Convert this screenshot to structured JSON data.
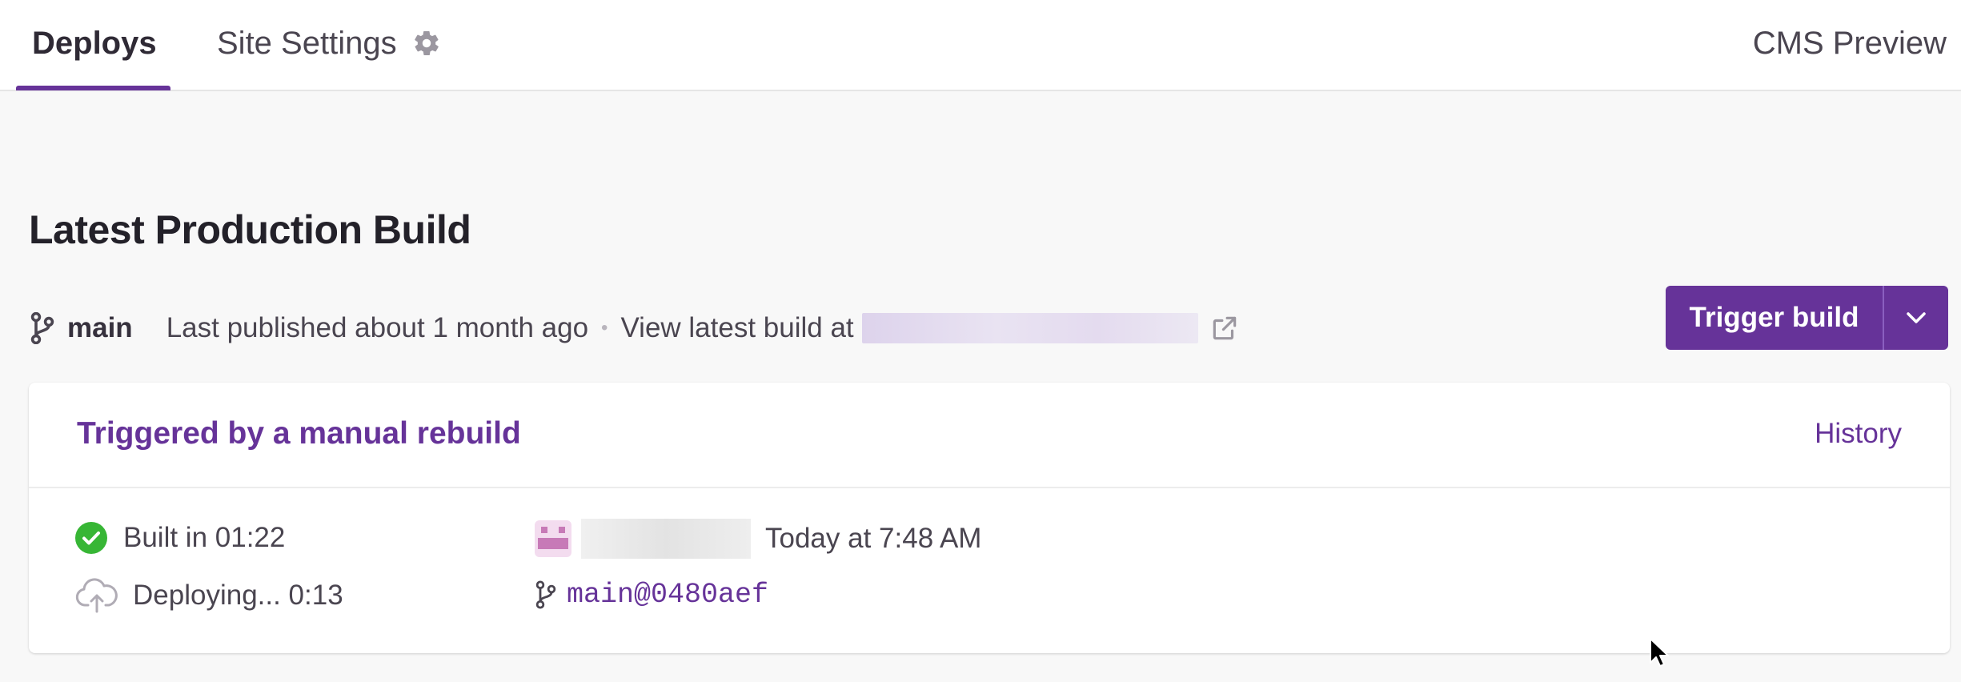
{
  "nav": {
    "tabs": [
      {
        "label": "Deploys",
        "active": true
      },
      {
        "label": "Site Settings",
        "icon": "gear-icon"
      }
    ],
    "cms_preview": "CMS Preview"
  },
  "latest_build": {
    "title": "Latest Production Build",
    "branch": "main",
    "published_text": "Last published about 1 month ago",
    "separator": "•",
    "view_latest_text": "View latest build at",
    "trigger_button": "Trigger build"
  },
  "card": {
    "title": "Triggered by a manual rebuild",
    "history_link": "History",
    "built_text": "Built in 01:22",
    "deploying_text": "Deploying... 0:13",
    "timestamp": "Today at 7:48 AM",
    "commit_ref": "main@0480aef"
  },
  "colors": {
    "accent": "#663399",
    "success": "#37b635",
    "background": "#f8f8f8"
  }
}
